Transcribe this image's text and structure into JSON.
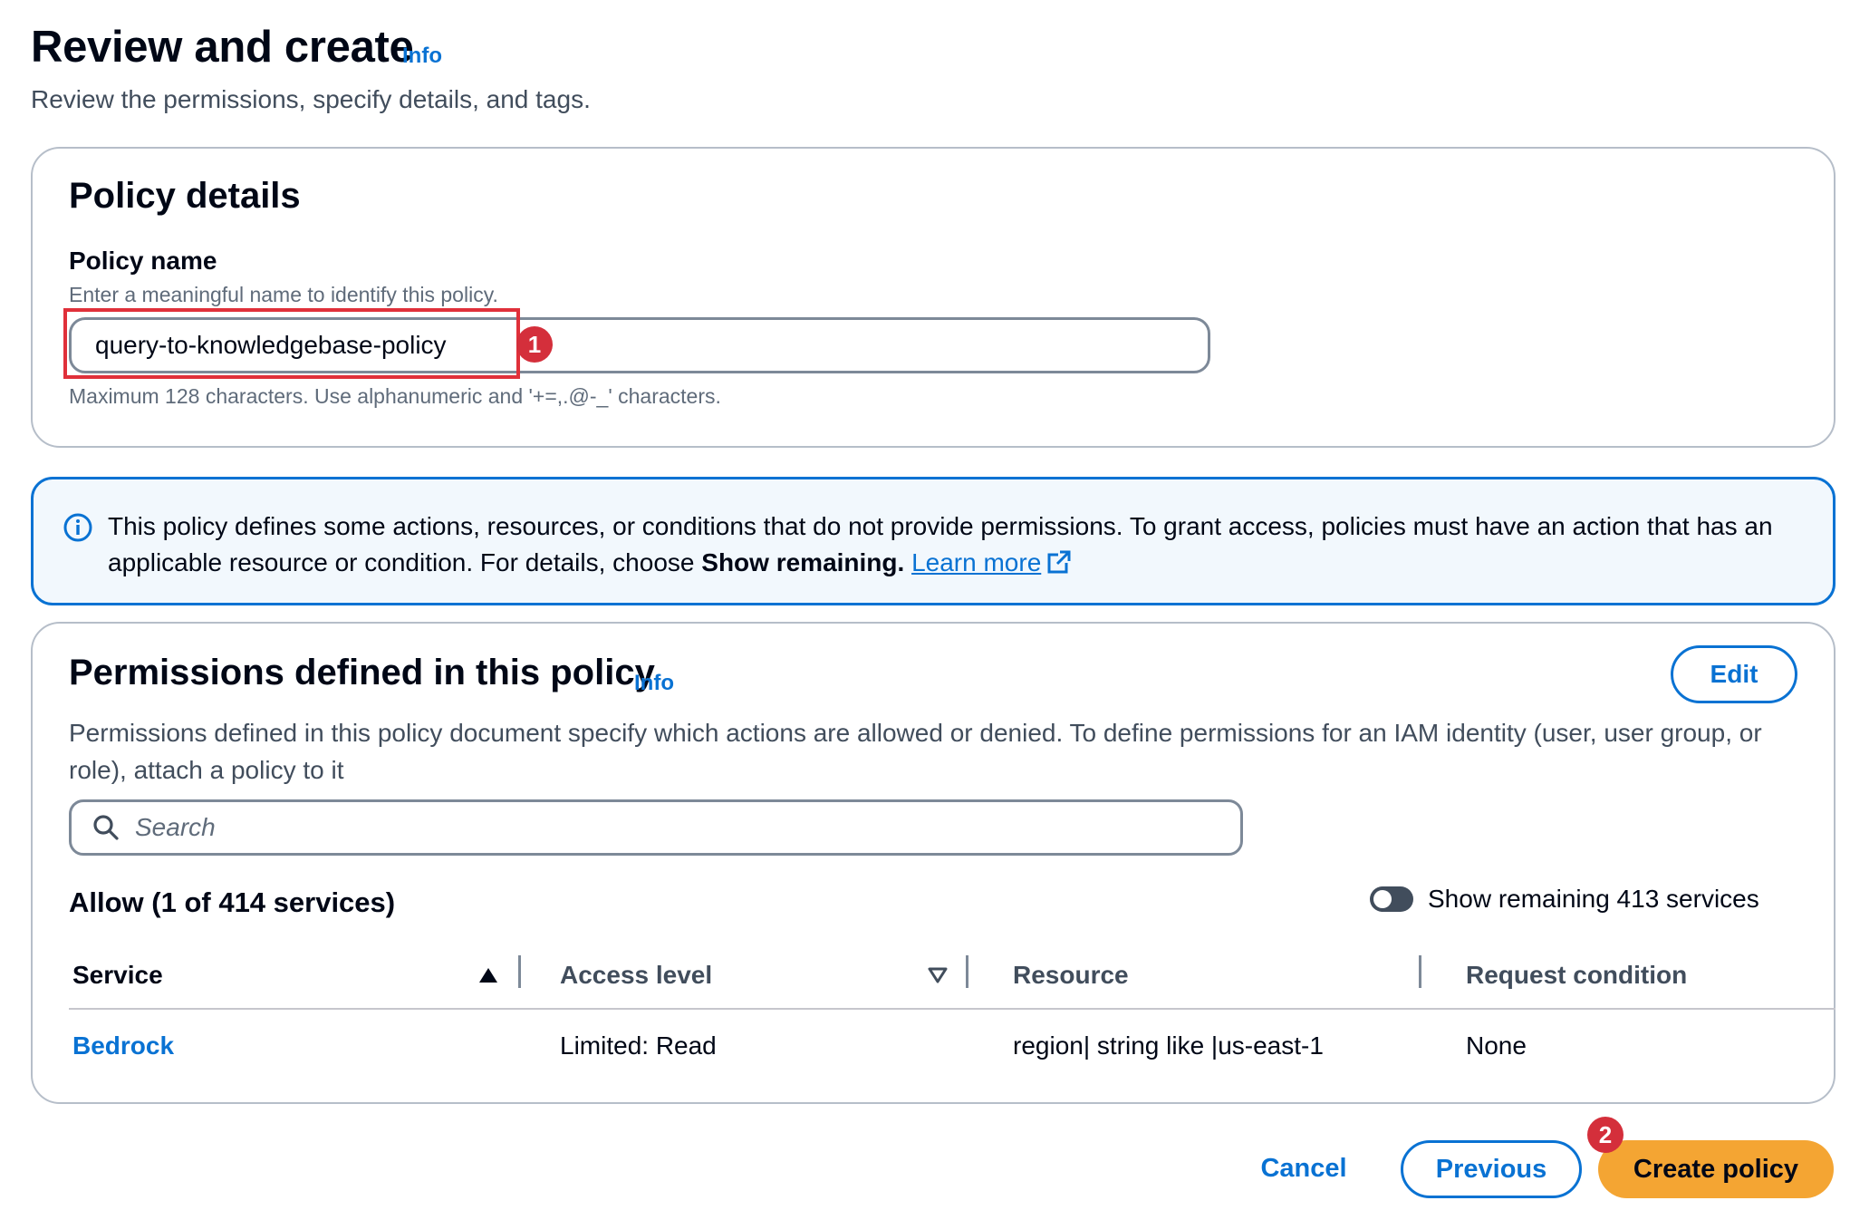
{
  "header": {
    "title": "Review and create",
    "info_label": "Info",
    "description": "Review the permissions, specify details, and tags."
  },
  "policy_details": {
    "title": "Policy details",
    "name_label": "Policy name",
    "name_description": "Enter a meaningful name to identify this policy.",
    "name_value": "query-to-knowledgebase-policy",
    "name_constraint": "Maximum 128 characters. Use alphanumeric and '+=,.@-_' characters."
  },
  "alert": {
    "text_part1": "This policy defines some actions, resources, or conditions that do not provide permissions. To grant access, policies must have an action that has an applicable resource or condition. For details, choose ",
    "text_bold": "Show remaining.",
    "learn_more": "Learn more"
  },
  "permissions": {
    "title": "Permissions defined in this policy",
    "info_label": "Info",
    "edit_label": "Edit",
    "description": "Permissions defined in this policy document specify which actions are allowed or denied. To define permissions for an IAM identity (user, user group, or role), attach a policy to it",
    "search_placeholder": "Search",
    "allow_heading": "Allow (1 of 414 services)",
    "toggle_label": "Show remaining 413 services",
    "toggle_on": false,
    "columns": [
      "Service",
      "Access level",
      "Resource",
      "Request condition"
    ],
    "rows": [
      {
        "service": "Bedrock",
        "access_level": "Limited: Read",
        "resource": "region| string like |us-east-1",
        "request_condition": "None"
      }
    ]
  },
  "annotations": [
    "1",
    "2"
  ],
  "footer": {
    "cancel_label": "Cancel",
    "previous_label": "Previous",
    "create_label": "Create policy"
  },
  "colors": {
    "link": "#0972d3",
    "primary_button": "#f4a533",
    "annotation": "#d42f3b",
    "alert_bg": "#f2f8fd"
  }
}
